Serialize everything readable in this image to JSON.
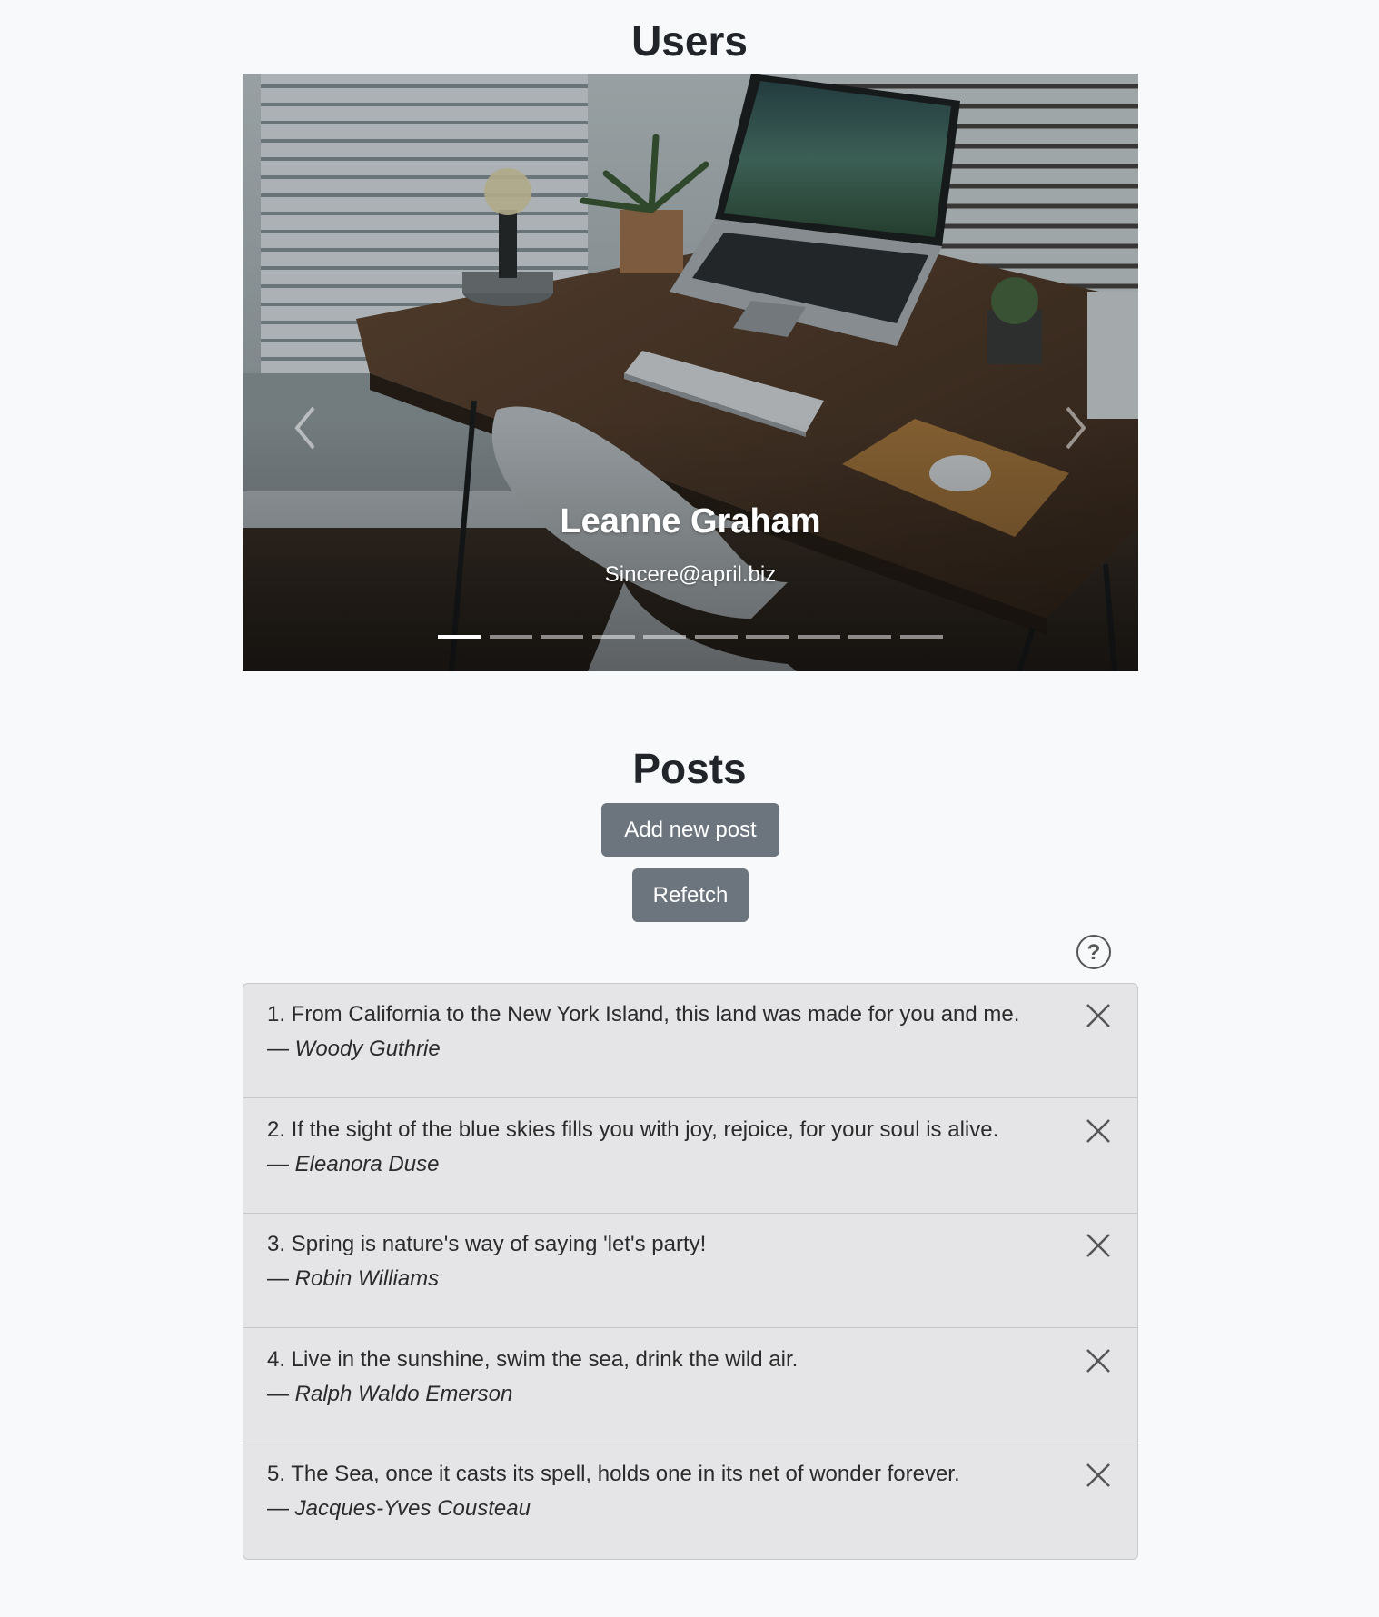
{
  "users": {
    "title": "Users",
    "carousel": {
      "active_index": 0,
      "slide_count": 10,
      "name": "Leanne Graham",
      "email": "Sincere@april.biz"
    }
  },
  "posts": {
    "title": "Posts",
    "add_button_label": "Add new post",
    "refetch_button_label": "Refetch",
    "help_icon": "question-circle-icon",
    "items": [
      {
        "text": "1. From California to the New York Island, this land was made for you and me.",
        "dash": "— ",
        "author": "Woody Guthrie"
      },
      {
        "text": "2. If the sight of the blue skies fills you with joy, rejoice, for your soul is alive.",
        "dash": "— ",
        "author": "Eleanora Duse"
      },
      {
        "text": "3. Spring is nature's way of saying 'let's party!",
        "dash": "— ",
        "author": "Robin Williams"
      },
      {
        "text": "4. Live in the sunshine, swim the sea, drink the wild air.",
        "dash": "— ",
        "author": "Ralph Waldo Emerson"
      },
      {
        "text": "5. The Sea, once it casts its spell, holds one in its net of wonder forever.",
        "dash": "— ",
        "author": "Jacques-Yves Cousteau"
      }
    ]
  },
  "colors": {
    "background": "#f8f9fa",
    "button": "#6c757d",
    "list_background": "#e5e5e7"
  }
}
